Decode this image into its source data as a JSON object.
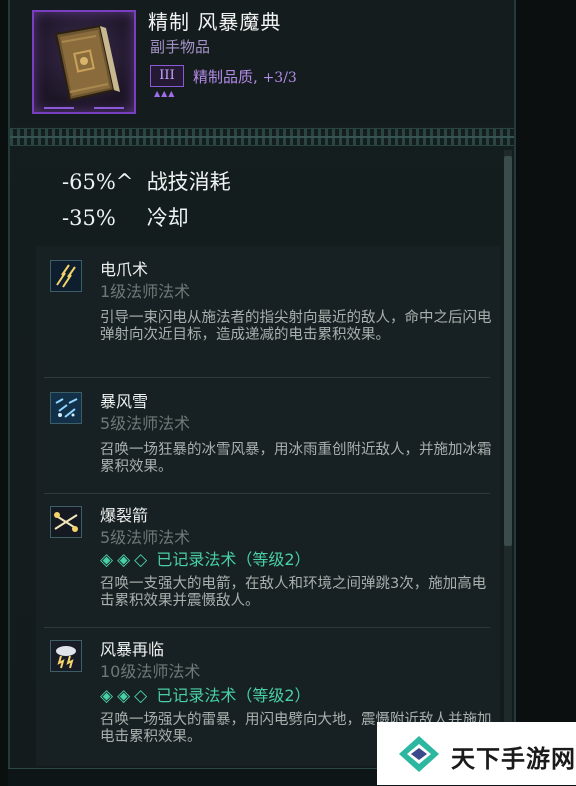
{
  "item": {
    "name": "精制 风暴魔典",
    "type": "副手物品",
    "quality_tier": "III",
    "quality_label": "精制品质,",
    "quality_value": "+3/3",
    "quality_dots": "▲▲▲"
  },
  "stats": [
    {
      "value": "-65%^",
      "label": "战技消耗"
    },
    {
      "value": "-35%",
      "label": "冷却"
    }
  ],
  "skills": [
    {
      "name": "电爪术",
      "level": "1级法师法术",
      "icon": "lightning-claw-icon",
      "description": "引导一束闪电从施法者的指尖射向最近的敌人，命中之后闪电弹射向次近目标，造成递减的电击累积效果。"
    },
    {
      "name": "暴风雪",
      "level": "5级法师法术",
      "icon": "blizzard-icon",
      "description": "召唤一场狂暴的冰雪风暴，用冰雨重创附近敌人，并施加冰霜累积效果。"
    },
    {
      "name": "爆裂箭",
      "level": "5级法师法术",
      "icon": "bursting-arrow-icon",
      "recorded_diamonds": "◈◈◇",
      "recorded": "已记录法术（等级2）",
      "description": "召唤一支强大的电箭，在敌人和环境之间弹跳3次，施加高电击累积效果并震慑敌人。"
    },
    {
      "name": "风暴再临",
      "level": "10级法师法术",
      "icon": "storm-cloud-icon",
      "recorded_diamonds": "◈◈◇",
      "recorded": "已记录法术（等级2）",
      "description": "召唤一场强大的雷暴，用闪电劈向大地，震慑附近敌人并施加电击累积效果。"
    }
  ],
  "watermark": {
    "text": "天下手游网"
  },
  "colors": {
    "rarity_purple": "#7a3fc0",
    "recorded_green": "#49cfa6",
    "panel_bg": "#151e1f"
  }
}
